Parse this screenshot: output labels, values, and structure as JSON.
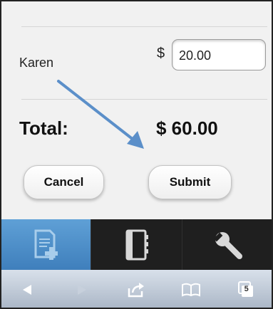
{
  "entry": {
    "name": "Karen",
    "currency_symbol": "$",
    "amount_value": "20.00"
  },
  "summary": {
    "total_label": "Total:",
    "total_value": "$ 60.00"
  },
  "buttons": {
    "cancel_label": "Cancel",
    "submit_label": "Submit"
  },
  "tabbar": {
    "tabs": [
      {
        "icon": "add-document-icon",
        "active": true
      },
      {
        "icon": "notebook-icon",
        "active": false
      },
      {
        "icon": "wrench-icon",
        "active": false
      }
    ]
  },
  "browser_toolbar": {
    "tab_count": "5",
    "icons": [
      "back-arrow-icon",
      "forward-arrow-icon",
      "share-icon",
      "bookmarks-icon",
      "tabs-icon"
    ]
  },
  "colors": {
    "accent": "#4a8ccb",
    "annotation_arrow": "#5b8fc9"
  }
}
